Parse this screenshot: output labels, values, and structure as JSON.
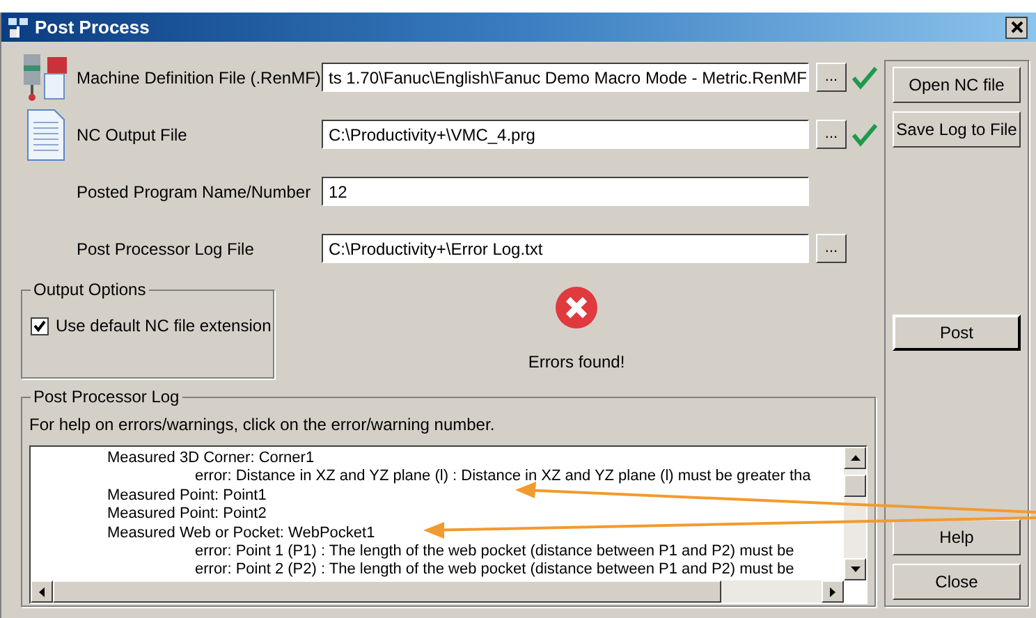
{
  "window": {
    "title": "Post Process"
  },
  "fields": [
    {
      "kind": "machine",
      "label": "Machine Definition File (.RenMF)",
      "value": "ts 1.70\\Fanuc\\English\\Fanuc Demo Macro Mode - Metric.RenMF",
      "browse": "...",
      "valid": true
    },
    {
      "kind": "document",
      "label": "NC Output File",
      "value": "C:\\Productivity+\\VMC_4.prg",
      "browse": "...",
      "valid": true
    },
    {
      "kind": "plain",
      "label": "Posted Program Name/Number",
      "value": "12"
    },
    {
      "kind": "plain",
      "label": "Post Processor Log File",
      "value": "C:\\Productivity+\\Error Log.txt",
      "browse": "...",
      "valid": false
    }
  ],
  "output_options": {
    "title": "Output Options",
    "checkbox": {
      "label": "Use default NC file extension",
      "checked": true
    }
  },
  "status": {
    "kind": "error",
    "text": "Errors found!"
  },
  "log": {
    "title": "Post Processor Log",
    "help": "For help on errors/warnings, click on the error/warning number.",
    "items": [
      {
        "text": "Measured 3D Corner: Corner1",
        "children": [
          {
            "text": "error: Distance in XZ and YZ plane (l) : Distance in XZ and YZ plane (l) must be greater tha"
          }
        ]
      },
      {
        "text": "Measured Point: Point1"
      },
      {
        "text": "Measured Point: Point2"
      },
      {
        "text": "Measured Web or Pocket: WebPocket1",
        "children": [
          {
            "text": "error: Point 1 (P1) : The length of the web pocket (distance between P1 and P2) must be"
          },
          {
            "text": "error: Point 2 (P2) : The length of the web pocket (distance between P1 and P2) must be"
          }
        ]
      }
    ]
  },
  "buttons": {
    "top": [
      "Open NC file",
      "Save Log to File"
    ],
    "middle": [
      "Post"
    ],
    "bottom": [
      "Help",
      "Close"
    ]
  }
}
